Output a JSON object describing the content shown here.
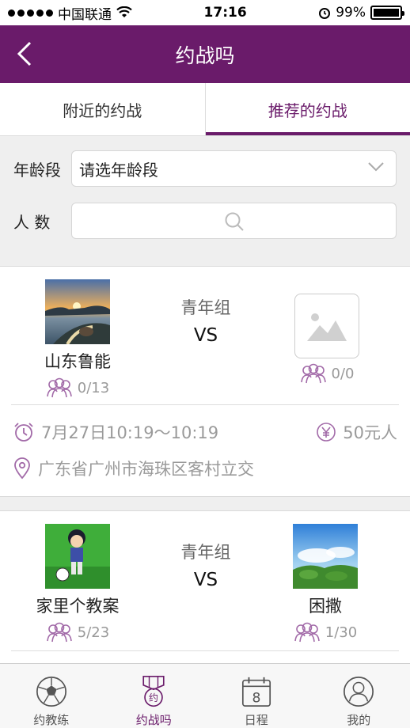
{
  "status": {
    "carrier": "中国联通",
    "time": "17:16",
    "battery": "99%",
    "battery_level": 0.99
  },
  "nav": {
    "title": "约战吗",
    "back_icon": "chevron-left-icon"
  },
  "tabs": [
    {
      "label": "附近的约战",
      "active": false
    },
    {
      "label": "推荐的约战",
      "active": true
    }
  ],
  "filters": {
    "age_label": "年龄段",
    "age_value": "请选年龄段",
    "count_label": "人 数",
    "count_placeholder": ""
  },
  "matches": [
    {
      "team_a": {
        "name": "山东鲁能",
        "count": "0/13"
      },
      "group": "青年组",
      "vs": "VS",
      "team_b": {
        "name": "",
        "count": "0/0"
      },
      "time": "7月27日10:19～10:19",
      "price": "50元人",
      "location": "广东省广州市海珠区客村立交"
    },
    {
      "team_a": {
        "name": "家里个教案",
        "count": "5/23"
      },
      "group": "青年组",
      "vs": "VS",
      "team_b": {
        "name": "困撒",
        "count": "1/30"
      }
    }
  ],
  "bottom_tabs": [
    {
      "label": "约教练",
      "icon": "soccer-ball-icon",
      "active": false
    },
    {
      "label": "约战吗",
      "icon": "medal-icon",
      "badge": "约",
      "active": true
    },
    {
      "label": "日程",
      "icon": "calendar-icon",
      "badge": "8",
      "active": false
    },
    {
      "label": "我的",
      "icon": "user-icon",
      "active": false
    }
  ],
  "colors": {
    "accent": "#6a1b6a",
    "background": "#efefef",
    "muted": "#9a9a9a"
  }
}
